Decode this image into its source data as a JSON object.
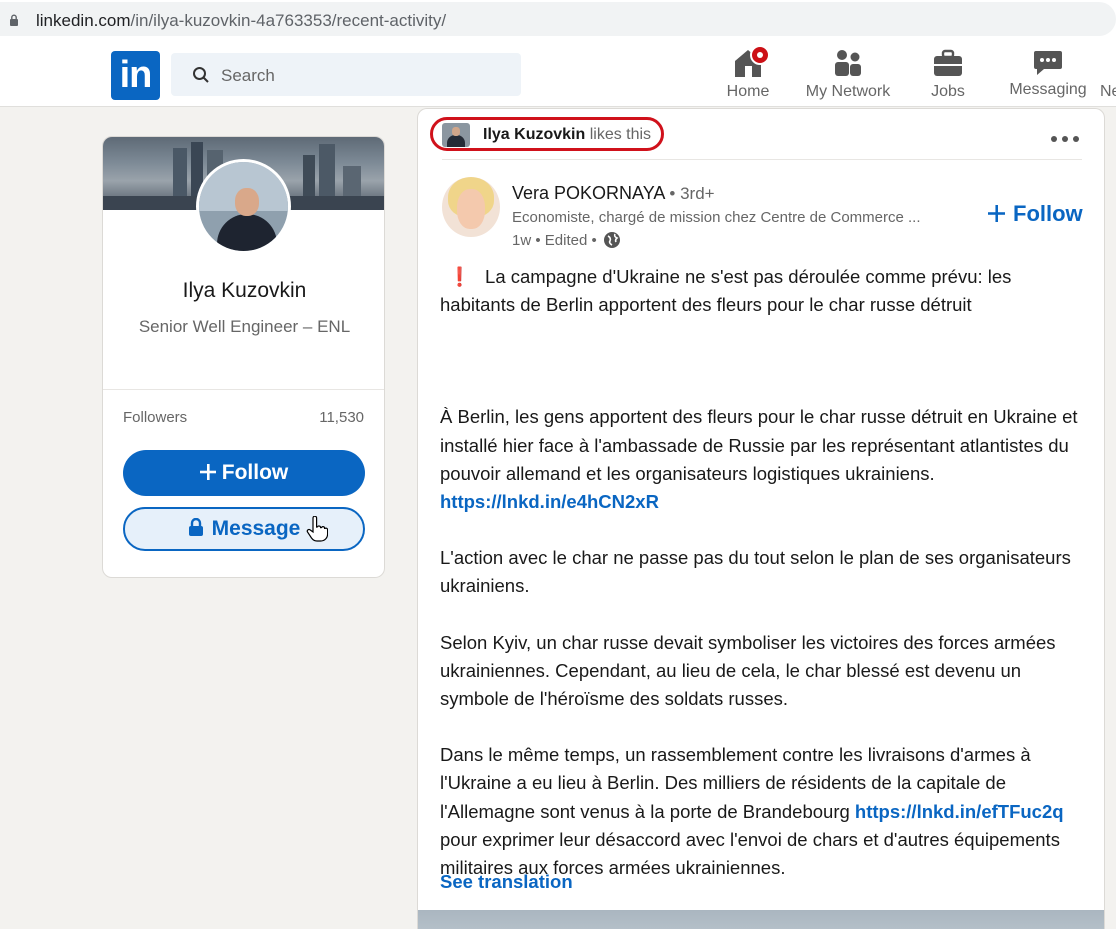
{
  "browser": {
    "url_host": "linkedin.com",
    "url_path": "/in/ilya-kuzovkin-4a763353/recent-activity/"
  },
  "nav": {
    "logo": "in",
    "search_placeholder": "Search",
    "items": [
      {
        "label": "Home",
        "icon": "home-icon"
      },
      {
        "label": "My Network",
        "icon": "my-network-icon"
      },
      {
        "label": "Jobs",
        "icon": "jobs-icon"
      },
      {
        "label": "Messaging",
        "icon": "messaging-icon"
      },
      {
        "label": "Ne"
      }
    ]
  },
  "profile": {
    "name": "Ilya Kuzovkin",
    "headline": "Senior Well Engineer – ENL",
    "followers_label": "Followers",
    "followers_count": "11,530",
    "follow_label": "Follow",
    "message_label": "Message"
  },
  "activity": {
    "liker_name": "Ilya Kuzovkin",
    "liker_action": "likes this",
    "author": {
      "name": "Vera POKORNAYA",
      "degree": "• 3rd+",
      "headline": "Economiste, chargé de mission chez Centre de Commerce ...",
      "time": "1w • Edited •"
    },
    "follow_label": "Follow",
    "excl_mark": "❗",
    "paragraph1": "La campagne d'Ukraine ne s'est pas déroulée comme prévu: les habitants de Berlin apportent des fleurs pour le char russe détruit",
    "paragraph2_text": "À Berlin, les gens apportent des fleurs pour le char russe détruit en Ukraine et installé hier face à l'ambassade de Russie par les représentant atlantistes du pouvoir allemand et les organisateurs logistiques ukrainiens. ",
    "paragraph2_link": "https://lnkd.in/e4hCN2xR",
    "paragraph3": "L'action avec le char ne passe pas du tout selon le plan de ses organisateurs ukrainiens.",
    "paragraph4": "Selon Kyiv, un char russe devait symboliser les victoires des forces armées ukrainiennes. Cependant, au lieu de cela, le char blessé est devenu un symbole de l'héroïsme des soldats russes.",
    "paragraph5_text": "Dans le même temps, un rassemblement contre les livraisons d'armes à l'Ukraine a eu lieu à Berlin. Des milliers de résidents de la capitale de l'Allemagne sont venus à la porte de Brandebourg ",
    "paragraph5_link": "https://lnkd.in/efTFuc2q",
    "paragraph5_tail": " pour exprimer leur désaccord avec l'envoi de chars et d'autres équipements militaires aux forces armées ukrainiennes.",
    "see_translation": "See translation"
  },
  "colors": {
    "brand": "#0a66c2",
    "highlight": "#d0111b",
    "background": "#f3f2ef"
  }
}
